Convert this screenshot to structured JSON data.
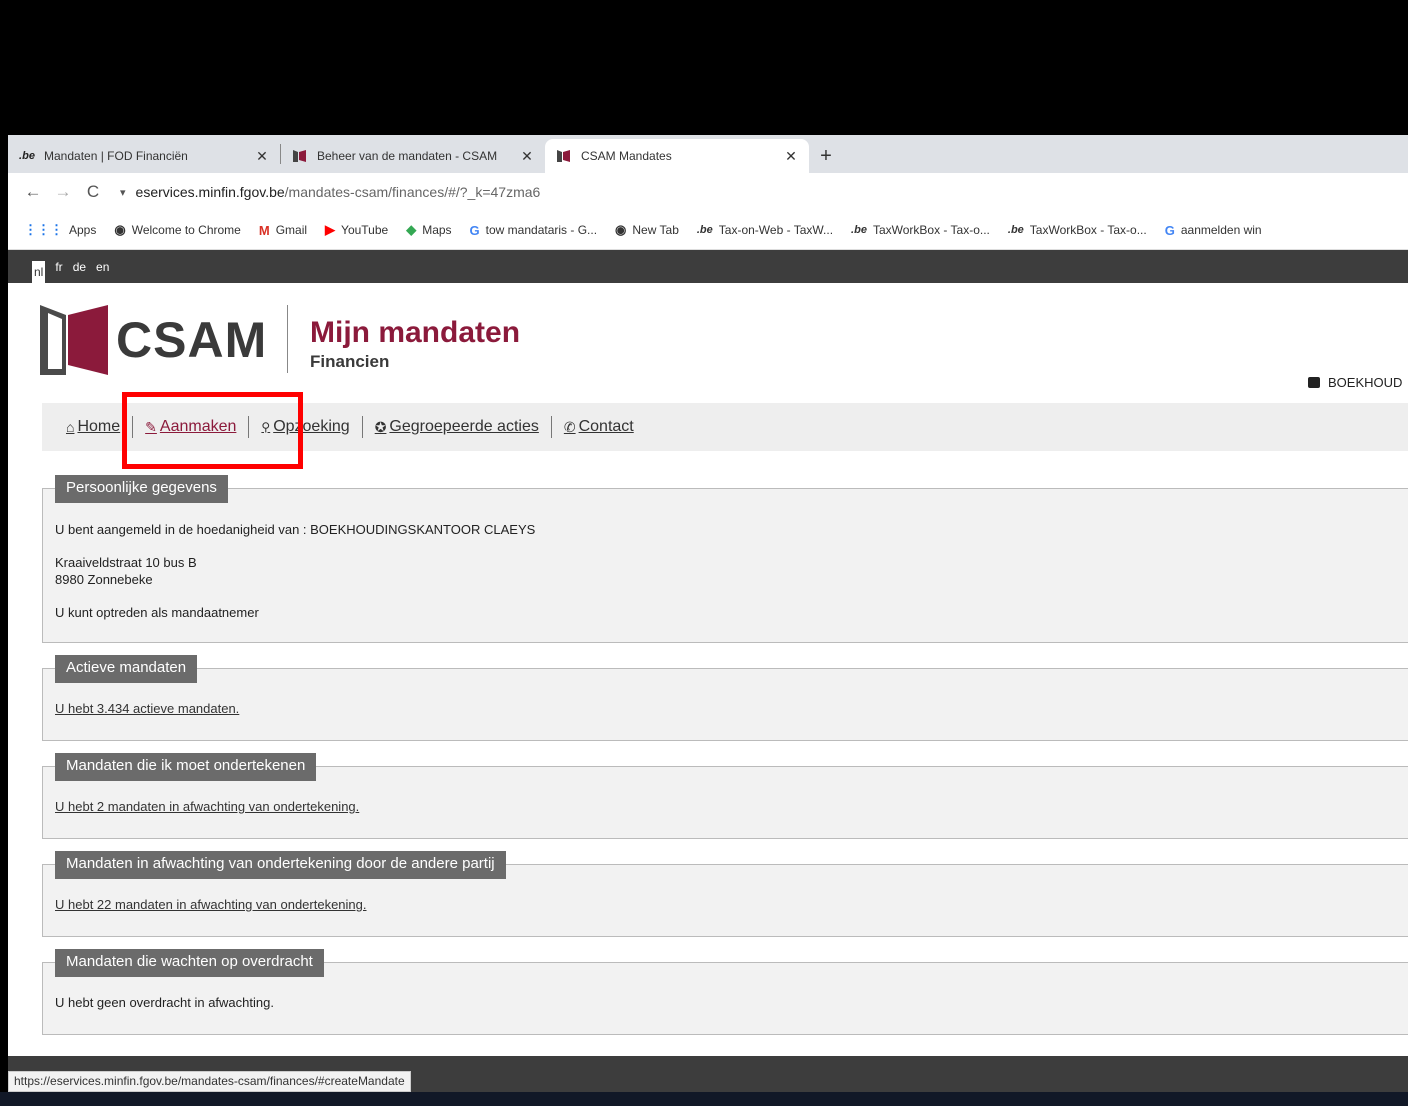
{
  "browser": {
    "tabs": [
      {
        "favicon": ".be",
        "title": "Mandaten | FOD Financiën",
        "active": false
      },
      {
        "favicon": "csam",
        "title": "Beheer van de mandaten - CSAM",
        "active": false
      },
      {
        "favicon": "csam",
        "title": "CSAM Mandates",
        "active": true
      }
    ],
    "address": {
      "host": "eservices.minfin.fgov.be",
      "path": "/mandates-csam/finances/#/?_k=47zma6"
    },
    "bookmarks": [
      {
        "icon": "apps",
        "label": "Apps"
      },
      {
        "icon": "chrome",
        "label": "Welcome to Chrome"
      },
      {
        "icon": "gmail",
        "label": "Gmail"
      },
      {
        "icon": "youtube",
        "label": "YouTube"
      },
      {
        "icon": "maps",
        "label": "Maps"
      },
      {
        "icon": "google",
        "label": "tow mandataris - G..."
      },
      {
        "icon": "chrome",
        "label": "New Tab"
      },
      {
        "icon": "be",
        "label": "Tax-on-Web - TaxW..."
      },
      {
        "icon": "be",
        "label": "TaxWorkBox - Tax-o..."
      },
      {
        "icon": "be",
        "label": "TaxWorkBox - Tax-o..."
      },
      {
        "icon": "google",
        "label": "aanmelden win"
      }
    ]
  },
  "page": {
    "languages": [
      "nl",
      "fr",
      "de",
      "en"
    ],
    "logo_text": "CSAM",
    "app_title": "Mijn mandaten",
    "app_subtitle": "Financien",
    "user_label": "BOEKHOUD",
    "nav": {
      "home": "Home",
      "create": "Aanmaken",
      "search": "Opzoeking",
      "grouped": "Gegroepeerde acties",
      "contact": "Contact"
    },
    "sections": {
      "personal": {
        "title": "Persoonlijke gegevens",
        "identity": "U bent aangemeld in de hoedanigheid van : BOEKHOUDINGSKANTOOR CLAEYS",
        "street": "Kraaiveldstraat 10 bus B",
        "city": "8980 Zonnebeke",
        "role": "U kunt optreden als mandaatnemer"
      },
      "active": {
        "title": "Actieve mandaten",
        "text": "U hebt 3.434 actieve mandaten."
      },
      "to_sign": {
        "title": "Mandaten die ik moet ondertekenen",
        "text": "U hebt 2 mandaten in afwachting van ondertekening."
      },
      "other_party": {
        "title": "Mandaten in afwachting van ondertekening door de andere partij",
        "text": "U hebt 22 mandaten in afwachting van ondertekening."
      },
      "transfer": {
        "title": "Mandaten die wachten op overdracht",
        "text": "U hebt geen overdracht in afwachting."
      }
    },
    "status_url": "https://eservices.minfin.fgov.be/mandates-csam/finances/#createMandate"
  },
  "colors": {
    "brand": "#8b1a3b",
    "highlight": "#ff0000",
    "legend_bg": "#6b6b6b"
  }
}
